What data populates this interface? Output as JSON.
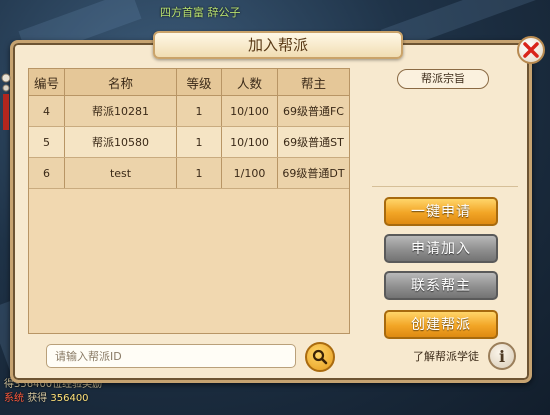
{
  "background": {
    "top_text": "四方首富 辞公子",
    "bottom_line1": "得356400位经验奖励",
    "bottom_tag": "系统",
    "bottom_gain": "获得",
    "bottom_value": "356400"
  },
  "dialog": {
    "title": "加入帮派",
    "close_icon": "close-icon"
  },
  "table": {
    "headers": [
      "编号",
      "名称",
      "等级",
      "人数",
      "帮主"
    ],
    "rows": [
      {
        "id": "4",
        "name": "帮派10281",
        "level": "1",
        "members": "10/100",
        "leader": "69级普通FC"
      },
      {
        "id": "5",
        "name": "帮派10580",
        "level": "1",
        "members": "10/100",
        "leader": "69级普通ST"
      },
      {
        "id": "6",
        "name": "test",
        "level": "1",
        "members": "1/100",
        "leader": "69级普通DT"
      }
    ]
  },
  "search": {
    "placeholder": "请输入帮派ID",
    "value": "",
    "icon": "search-icon"
  },
  "right_panel": {
    "section_title": "帮派宗旨",
    "buttons": {
      "quick_apply": "一键申请",
      "apply_join": "申请加入",
      "contact_leader": "联系帮主",
      "create_guild": "创建帮派"
    },
    "learn_label": "了解帮派学徒",
    "info_icon_text": "i"
  },
  "colors": {
    "panel_bg": "#f7e9cf",
    "orange_button": "#f2a526",
    "grey_button": "#8f8f8f",
    "close_red": "#d9241b"
  }
}
